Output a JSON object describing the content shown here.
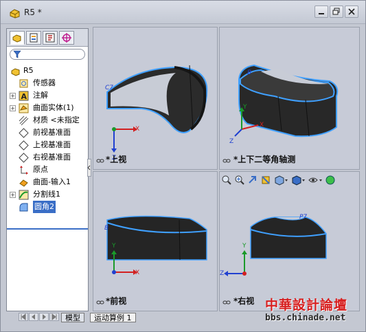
{
  "window": {
    "title": "R5 *"
  },
  "panel": {
    "tabs": [
      "feature-manager",
      "property-manager",
      "configuration-manager",
      "dimxpert-manager"
    ],
    "tree": [
      {
        "label": "R5",
        "icon": "part-icon",
        "expandable": false,
        "root": true
      },
      {
        "label": "传感器",
        "icon": "sensor-icon",
        "expandable": false
      },
      {
        "label": "注解",
        "icon": "annotation-icon",
        "expandable": true
      },
      {
        "label": "曲面实体(1)",
        "icon": "surface-bodies-icon",
        "expandable": true
      },
      {
        "label": "材质 <未指定",
        "icon": "material-icon",
        "expandable": false
      },
      {
        "label": "前视基准面",
        "icon": "plane-icon",
        "expandable": false
      },
      {
        "label": "上视基准面",
        "icon": "plane-icon",
        "expandable": false
      },
      {
        "label": "右视基准面",
        "icon": "plane-icon",
        "expandable": false
      },
      {
        "label": "原点",
        "icon": "origin-icon",
        "expandable": false
      },
      {
        "label": "曲面-输入1",
        "icon": "imported-surface-icon",
        "expandable": false
      },
      {
        "label": "分割线1",
        "icon": "split-line-icon",
        "expandable": true
      },
      {
        "label": "圆角2",
        "icon": "fillet-icon",
        "expandable": false,
        "selected": true
      }
    ]
  },
  "viewports": {
    "top": {
      "label": "*上视"
    },
    "dimetric": {
      "label": "*上下二等角轴测"
    },
    "front": {
      "label": "*前视"
    },
    "right": {
      "label": "*右视"
    }
  },
  "toolbar": {
    "icons": [
      "zoom-to-fit-icon",
      "zoom-to-area-icon",
      "previous-view-icon",
      "section-view-icon",
      "view-orientation-icon",
      "display-style-icon",
      "hide-show-items-icon",
      "edit-appearance-icon"
    ]
  },
  "bottom_tabs": {
    "model": "模型",
    "motion": "运动算例 1"
  },
  "watermark": {
    "title": "中華設計論壇",
    "url": "bbs.chinade.net"
  },
  "colors": {
    "accent": "#3a6ec6",
    "edge_highlight": "#3fa0ff",
    "axis_x": "#d22020",
    "axis_y": "#1a9a2a",
    "axis_z": "#2040d0"
  }
}
